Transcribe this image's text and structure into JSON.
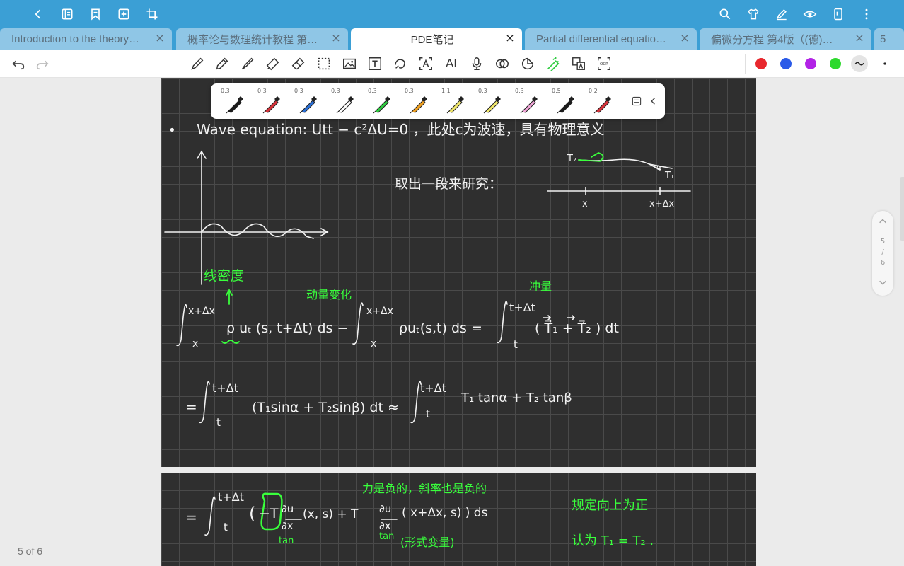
{
  "tabs": [
    {
      "title": "Introduction to the theory…",
      "close": "×"
    },
    {
      "title": "概率论与数理统计教程 第…",
      "close": "×"
    },
    {
      "title": "PDE笔记",
      "close": "×",
      "active": true
    },
    {
      "title": "Partial differential equatio…",
      "close": "×"
    },
    {
      "title": "偏微分方程 第4版（(德)…",
      "close": "×"
    },
    {
      "title": "5"
    }
  ],
  "topbar_icons_left": [
    "back-icon",
    "book-icon",
    "bookmark-icon",
    "add-page-icon",
    "crop-icon"
  ],
  "topbar_icons_right": [
    "search-icon",
    "shirt-icon",
    "pen-icon",
    "eye-icon",
    "phone-icon",
    "more-icon"
  ],
  "toolbar": {
    "tools": [
      "fountain-pen-icon",
      "pencil-icon",
      "brush-icon",
      "highlighter-icon",
      "eraser-icon",
      "lasso-select-icon",
      "image-icon",
      "textbox-icon",
      "shape-icon",
      "text-recognize-icon",
      "ai-icon",
      "microphone-icon",
      "audio-icon",
      "sticker-icon",
      "laser-pointer-icon",
      "translate-icon",
      "ocr-icon"
    ],
    "ai_label": "AI",
    "ocr_label": "OCR",
    "colors": [
      "#e8272d",
      "#2a5ae8",
      "#b223e6",
      "#2ed92e"
    ],
    "selected_stroke": "wavy-stroke-icon"
  },
  "pens": [
    {
      "size": "0.3",
      "color": "#1a1a1a"
    },
    {
      "size": "0.3",
      "color": "#d8323a"
    },
    {
      "size": "0.3",
      "color": "#2a6fd6"
    },
    {
      "size": "0.3",
      "color": "#ffffff"
    },
    {
      "size": "0.3",
      "color": "#2ecc40"
    },
    {
      "size": "0.3",
      "color": "#f0a020"
    },
    {
      "size": "1.1",
      "color": "#f2e86a"
    },
    {
      "size": "0.3",
      "color": "#f2e86a"
    },
    {
      "size": "0.3",
      "color": "#f2a6d9"
    },
    {
      "size": "0.5",
      "color": "#1a1a1a"
    },
    {
      "size": "0.2",
      "color": "#d8323a"
    }
  ],
  "scroller": {
    "current": "5",
    "sep": "/",
    "total": "6"
  },
  "page_count": "5 of 6",
  "notes": {
    "line1_bullet": "•",
    "line1": "Wave equation:   Utt − c²ΔU=0  ，此处c为波速，具有物理意义",
    "take_segment": "取出一段来研究：",
    "diagram_T2": "T₂",
    "diagram_T1": "T₁",
    "diagram_alpha": "α",
    "diagram_x": "x",
    "diagram_xdx": "x+Δx",
    "density_label": "线密度",
    "momentum_label": "动量变化",
    "impulse_label": "冲量",
    "eq1_upper1": "x+Δx",
    "eq1_lower1": "x",
    "eq1_body1": "ρ uₜ (s, t+Δt) ds  −",
    "eq1_upper2": "x+Δx",
    "eq1_lower2": "x",
    "eq1_body2": "ρuₜ(s,t) ds  =",
    "eq1_upper3": "t+Δt",
    "eq1_lower3": "t",
    "eq1_body3": "( T⃗₁ + T⃗₂ ) dt",
    "eq2_eq": "=",
    "eq2_upper1": "t+Δt",
    "eq2_lower1": "t",
    "eq2_body1": "(T₁sinα + T₂sinβ)  dt   ≈",
    "eq2_upper2": "t+Δt",
    "eq2_lower2": "t",
    "eq2_body2": "T₁ tanα + T₂ tanβ",
    "eq3_eq": "=",
    "eq3_upper": "t+Δt",
    "eq3_lower": "t",
    "eq3_open": "(",
    "eq3_minusT": "−T",
    "eq3_frac_num1": "∂u",
    "eq3_frac_den1": "∂x",
    "eq3_arg1": "(x, s)  +  T",
    "eq3_frac_num2": "∂u",
    "eq3_frac_den2": "∂x",
    "eq3_arg2": "( x+Δx, s) )  ds",
    "tan1": "tan",
    "tan2": "tan",
    "force_note": "力是负的，斜率也是负的",
    "formal_var": "(形式变量)",
    "positive_up": "规定向上为正",
    "T_equal": "认为 T₁ = T₂ ."
  }
}
